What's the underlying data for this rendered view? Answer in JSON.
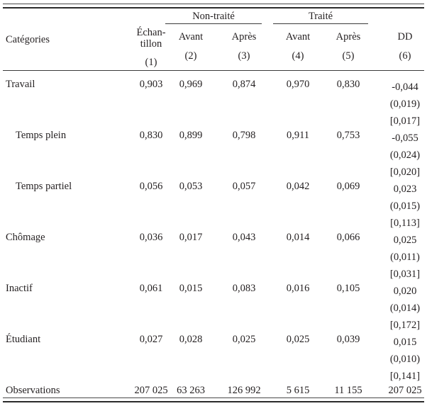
{
  "table": {
    "stub_header": "Catégories",
    "group_headers": [
      {
        "label": "Non-traité"
      },
      {
        "label": "Traité"
      }
    ],
    "columns": [
      {
        "label": "Échan-",
        "label2": "tillon",
        "number": "(1)"
      },
      {
        "label": "Avant",
        "number": "(2)"
      },
      {
        "label": "Après",
        "number": "(3)"
      },
      {
        "label": "Avant",
        "number": "(4)"
      },
      {
        "label": "Après",
        "number": "(5)"
      },
      {
        "label": "DD",
        "number": "(6)"
      }
    ],
    "rows": [
      {
        "label": "Travail",
        "indent": false,
        "sample": "0,903",
        "untreated_before": "0,969",
        "untreated_after": "0,874",
        "treated_before": "0,970",
        "treated_after": "0,830",
        "dd_estimate": "-0,044",
        "dd_se": "(0,019)",
        "dd_pvalue": "[0,017]"
      },
      {
        "label": "Temps plein",
        "indent": true,
        "sample": "0,830",
        "untreated_before": "0,899",
        "untreated_after": "0,798",
        "treated_before": "0,911",
        "treated_after": "0,753",
        "dd_estimate": "-0,055",
        "dd_se": "(0,024)",
        "dd_pvalue": "[0,020]"
      },
      {
        "label": "Temps partiel",
        "indent": true,
        "sample": "0,056",
        "untreated_before": "0,053",
        "untreated_after": "0,057",
        "treated_before": "0,042",
        "treated_after": "0,069",
        "dd_estimate": "0,023",
        "dd_se": "(0,015)",
        "dd_pvalue": "[0,113]"
      },
      {
        "label": "Chômage",
        "indent": false,
        "sample": "0,036",
        "untreated_before": "0,017",
        "untreated_after": "0,043",
        "treated_before": "0,014",
        "treated_after": "0,066",
        "dd_estimate": "0,025",
        "dd_se": "(0,011)",
        "dd_pvalue": "[0,031]"
      },
      {
        "label": "Inactif",
        "indent": false,
        "sample": "0,061",
        "untreated_before": "0,015",
        "untreated_after": "0,083",
        "treated_before": "0,016",
        "treated_after": "0,105",
        "dd_estimate": "0,020",
        "dd_se": "(0,014)",
        "dd_pvalue": "[0,172]"
      },
      {
        "label": "Étudiant",
        "indent": false,
        "sample": "0,027",
        "untreated_before": "0,028",
        "untreated_after": "0,025",
        "treated_before": "0,025",
        "treated_after": "0,039",
        "dd_estimate": "0,015",
        "dd_se": "(0,010)",
        "dd_pvalue": "[0,141]"
      }
    ],
    "observations": {
      "label": "Observations",
      "sample": "207 025",
      "untreated_before": "63 263",
      "untreated_after": "126 992",
      "treated_before": "5 615",
      "treated_after": "11 155",
      "dd": "207 025"
    }
  }
}
